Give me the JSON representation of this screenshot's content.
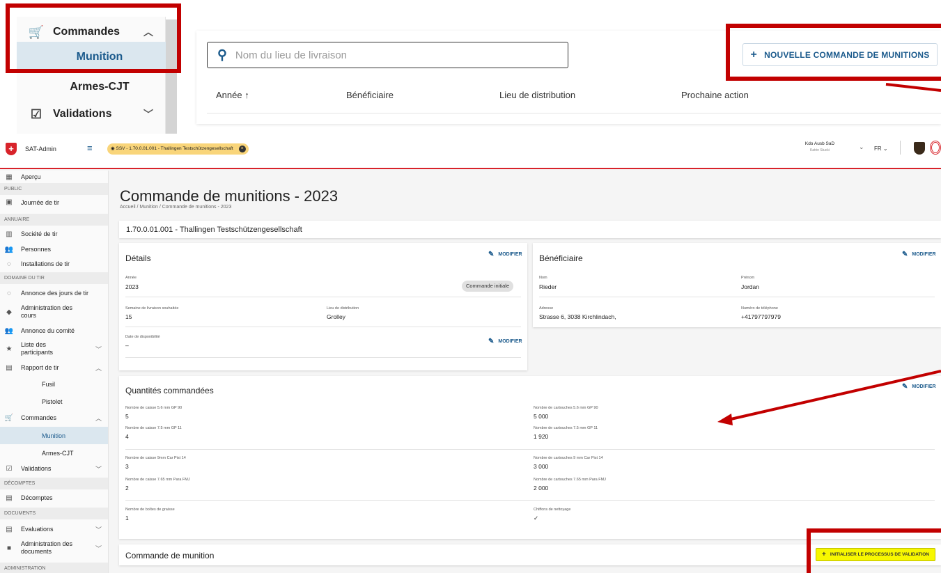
{
  "zoom": {
    "sidebar": {
      "commandes_label": "Commandes",
      "munition_label": "Munition",
      "armes_label": "Armes-CJT",
      "validations_label": "Validations"
    },
    "search": {
      "placeholder": "Nom du lieu de livraison"
    },
    "new_order_button": "NOUVELLE COMMANDE DE MUNITIONS",
    "columns": [
      "Année",
      "Bénéficiaire",
      "Lieu de distribution",
      "Prochaine action"
    ]
  },
  "topbar": {
    "app_name": "SAT-Admin",
    "context_chip": "SSV - 1.70.0.01.001 - Thallingen Testschützengesellschaft",
    "user_org": "Kdo Ausb SaD",
    "user_name": "Katrin Stucki",
    "language": "FR"
  },
  "sidebar": {
    "apercu": "Aperçu",
    "sec_public": "PUBLIC",
    "journee": "Journée de tir",
    "sec_annuaire": "ANNUAIRE",
    "societe": "Société de tir",
    "personnes": "Personnes",
    "installations": "Installations de tir",
    "sec_domaine": "DOMAINE DU TIR",
    "annonce_jours": "Annonce des jours de tir",
    "admin_cours": "Administration des cours",
    "annonce_comite": "Annonce du comité",
    "liste_participants": "Liste des participants",
    "rapport": "Rapport de tir",
    "fusil": "Fusil",
    "pistolet": "Pistolet",
    "commandes": "Commandes",
    "munition": "Munition",
    "armes": "Armes-CJT",
    "validations": "Validations",
    "sec_decomptes": "DÉCOMPTES",
    "decomptes": "Décomptes",
    "sec_documents": "DOCUMENTS",
    "evaluations": "Evaluations",
    "admin_documents": "Administration des documents",
    "sec_administration": "ADMINISTRATION"
  },
  "page": {
    "title": "Commande de munitions - 2023",
    "breadcrumb": [
      "Accueil",
      "Munition",
      "Commande de munitions - 2023"
    ],
    "society": "1.70.0.01.001 - Thallingen Testschützengesellschaft",
    "modify_label": "MODIFIER"
  },
  "details": {
    "title": "Détails",
    "annee_label": "Année",
    "annee": "2023",
    "badge": "Commande initiale",
    "semaine_label": "Semaine de livraison souhaitée",
    "semaine": "15",
    "lieu_label": "Lieu de distribution",
    "lieu": "Grolley",
    "dispo_label": "Date de disponibilité",
    "dispo": "–"
  },
  "beneficiaire": {
    "title": "Bénéficiaire",
    "nom_label": "Nom",
    "nom": "Rieder",
    "prenom_label": "Prénom",
    "prenom": "Jordan",
    "adresse_label": "Adresse",
    "adresse": "Strasse 6, 3038 Kirchlindach,",
    "tel_label": "Numéro de téléphone",
    "tel": "+41797797979"
  },
  "quantites": {
    "title": "Quantités commandées",
    "c1_label": "Nombre de caisse 5.6 mm GP 90",
    "c1": "5",
    "k1_label": "Nombre de cartouches 5.6 mm GP 90",
    "k1": "5 000",
    "c2_label": "Nombre de caisse 7.5 mm GP 11",
    "c2": "4",
    "k2_label": "Nombre de cartouches 7.5 mm GP 11",
    "k2": "1 920",
    "c3_label": "Nombre de caisse 9mm Car Pist 14",
    "c3": "3",
    "k3_label": "Nombre de cartouches 9 mm Car Pist 14",
    "k3": "3 000",
    "c4_label": "Nombre de caisse 7.65 mm Para FMJ",
    "c4": "2",
    "k4_label": "Nombre de cartouches 7.65 mm Para FMJ",
    "k4": "2 000",
    "graisse_label": "Nombre de boîtes de graisse",
    "graisse": "1",
    "chiffons_label": "Chiffons de nettoyage",
    "chiffons": "✓"
  },
  "commande": {
    "title": "Commande de munition",
    "validate_button": "INITIALISER LE PROCESSUS DE VALIDATION"
  },
  "colors": {
    "accent": "#1b5a8c",
    "swiss_red": "#d8232a",
    "annotation_red": "#c20000",
    "highlight_yellow": "#f7f700"
  }
}
